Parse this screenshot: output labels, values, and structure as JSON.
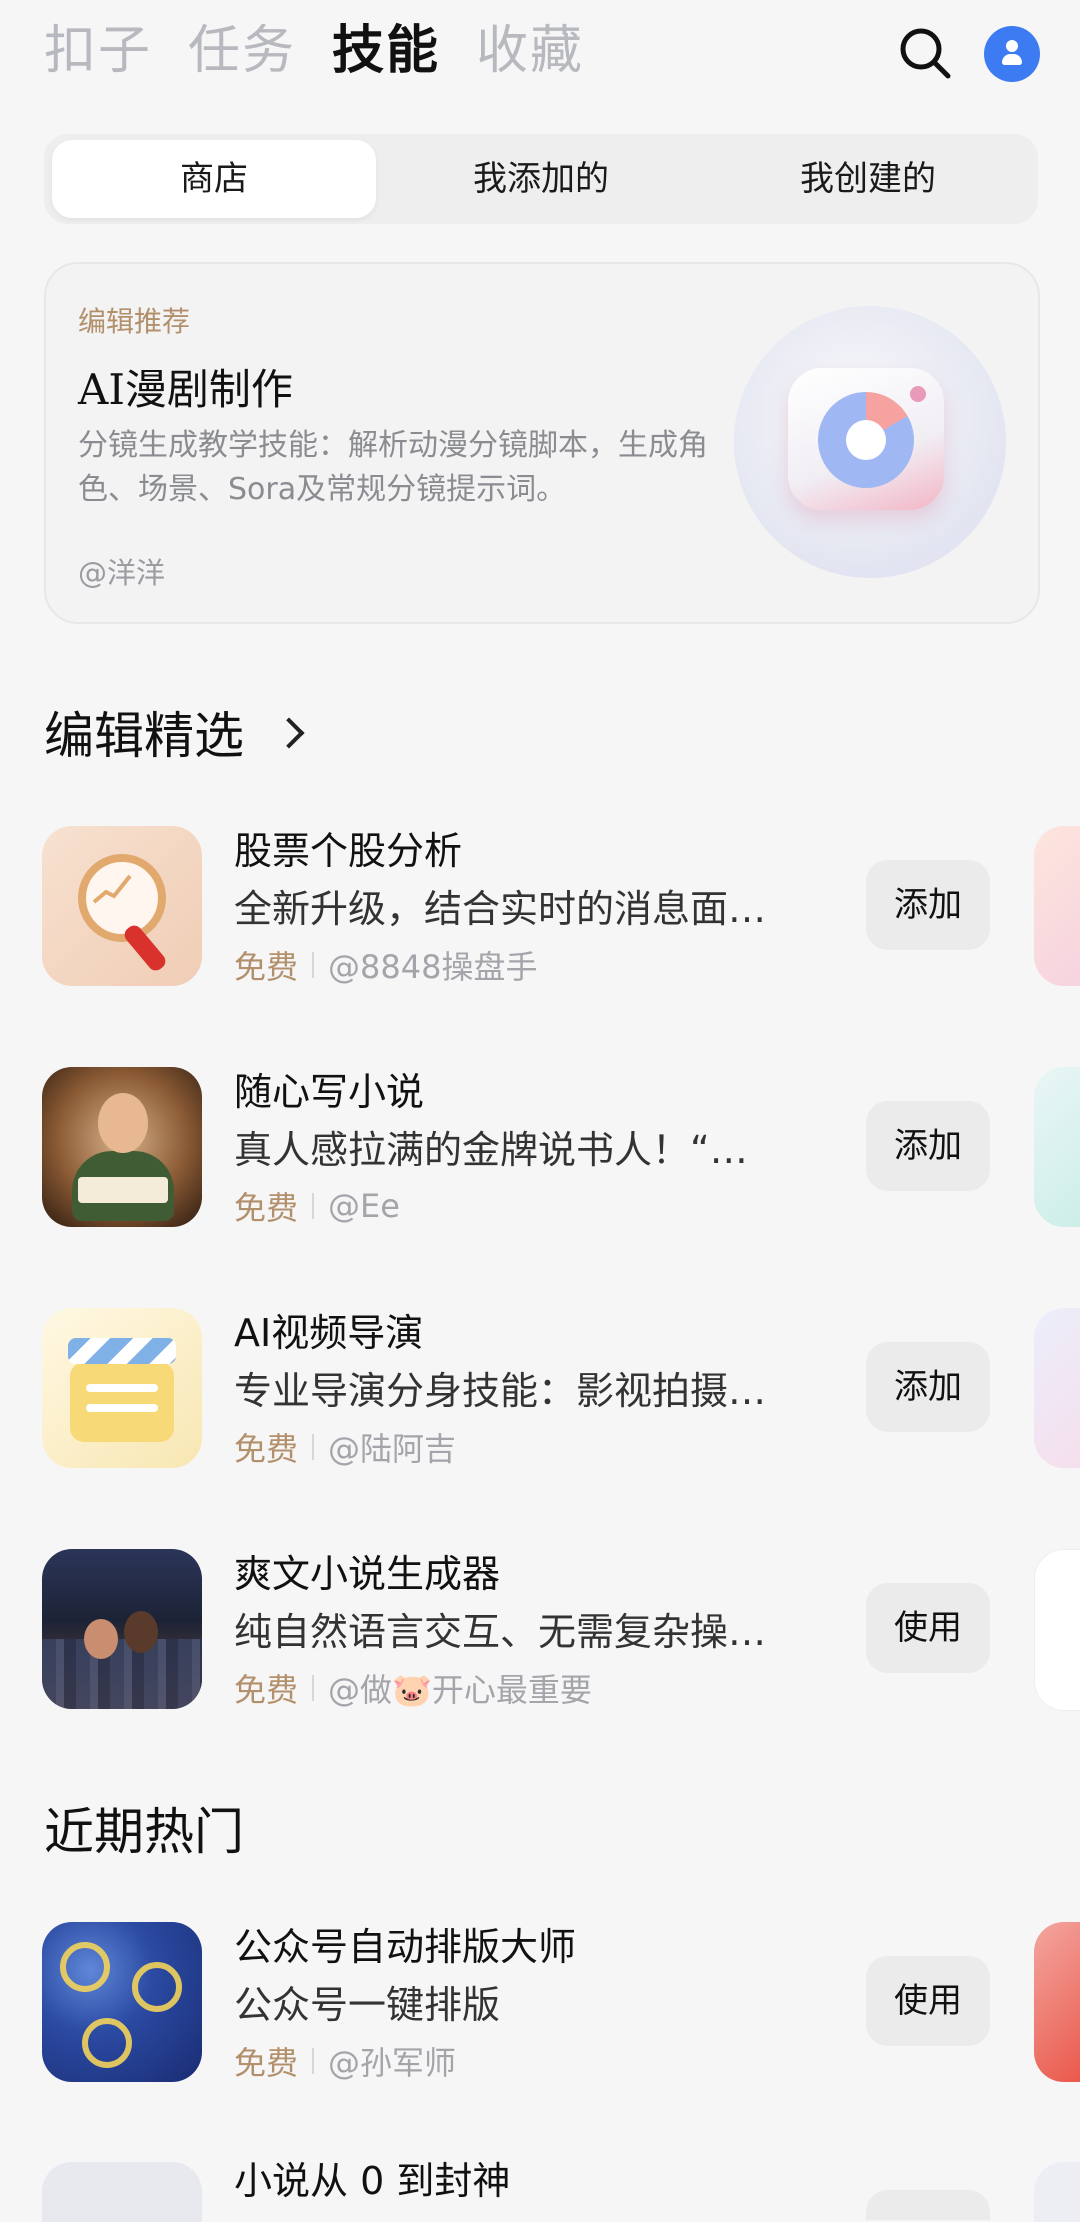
{
  "topnav": {
    "tabs": [
      {
        "label": "扣子"
      },
      {
        "label": "任务"
      },
      {
        "label": "技能"
      },
      {
        "label": "收藏"
      }
    ],
    "active_tab": "技能",
    "search_icon": "search-icon",
    "avatar_icon": "user-icon",
    "accent": "#3d7bf2"
  },
  "segment": {
    "items": [
      {
        "label": "商店"
      },
      {
        "label": "我添加的"
      },
      {
        "label": "我创建的"
      }
    ],
    "active": "商店"
  },
  "featured": {
    "tag": "编辑推荐",
    "title": "AI漫剧制作",
    "description": "分镜生成教学技能：解析动漫分镜脚本，生成角色、场景、Sora及常规分镜提示词。",
    "author": "@洋洋",
    "icon": "camera-app-icon"
  },
  "editor_picks": {
    "title": "编辑精选",
    "items": [
      {
        "name": "股票个股分析",
        "description": "全新升级，结合实时的消息面…",
        "price": "免费",
        "author": "@8848操盘手",
        "button": "添加",
        "icon": "magnifier-chart-icon"
      },
      {
        "name": "随心写小说",
        "description": "真人感拉满的金牌说书人！“…",
        "price": "免费",
        "author": "@Ee",
        "button": "添加",
        "icon": "storyteller-icon"
      },
      {
        "name": "AI视频导演",
        "description": "专业导演分身技能：影视拍摄…",
        "price": "免费",
        "author": "@陆阿吉",
        "button": "添加",
        "icon": "clapperboard-icon"
      },
      {
        "name": "爽文小说生成器",
        "description": "纯自然语言交互、无需复杂操…",
        "price": "免费",
        "author": "@做🐷开心最重要",
        "button": "使用",
        "icon": "city-couple-icon"
      }
    ]
  },
  "trending": {
    "title": "近期热门",
    "items": [
      {
        "name": "公众号自动排版大师",
        "description": "公众号一键排版",
        "price": "免费",
        "author": "@孙军师",
        "button": "使用",
        "icon": "starry-night-icon"
      },
      {
        "name": "小说从 0 到封神"
      }
    ]
  },
  "colors": {
    "price": "#b3906c",
    "background": "#f6f6f7"
  }
}
